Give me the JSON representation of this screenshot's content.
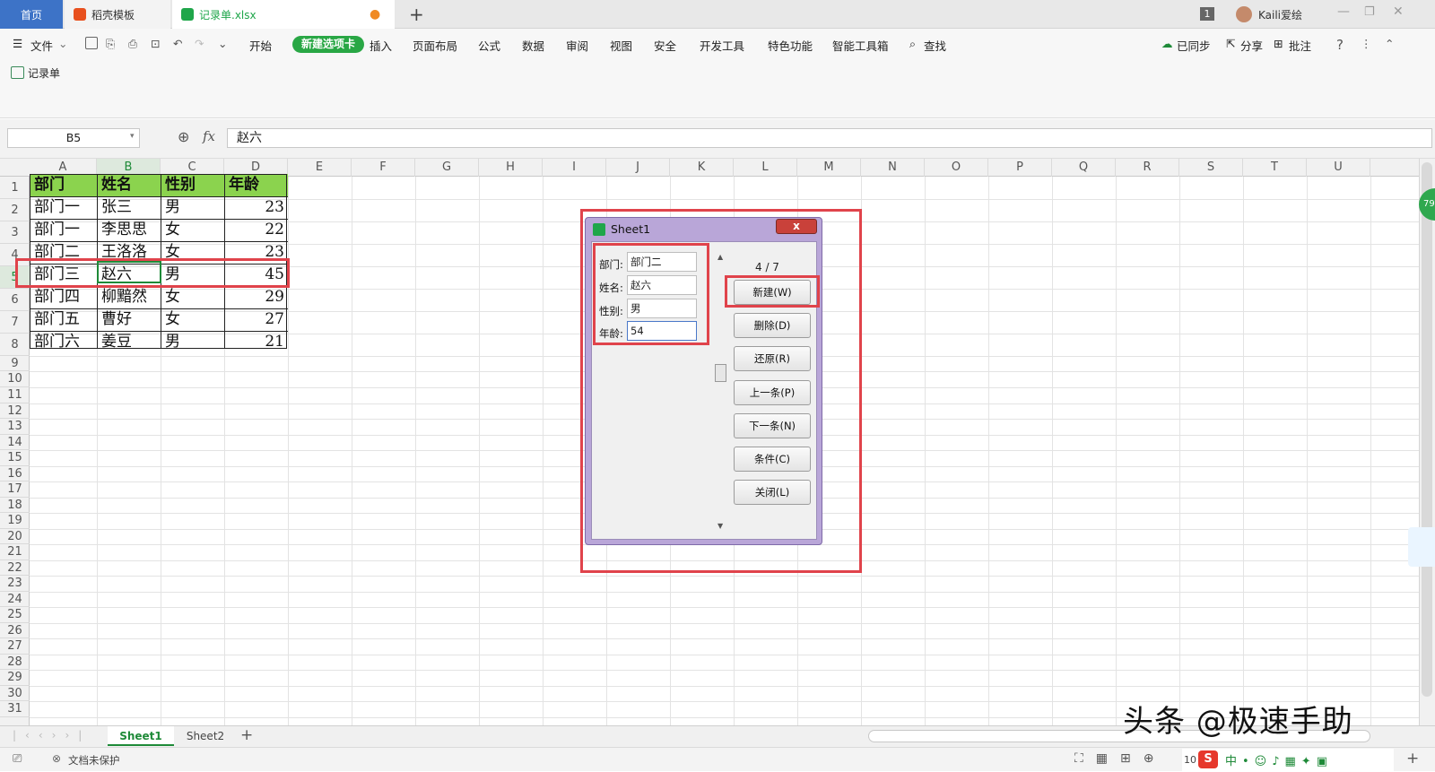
{
  "tabs": {
    "home": "首页",
    "template": "稻壳模板",
    "document": "记录单.xlsx",
    "new_tab_symbol": "+",
    "badge": "1",
    "user": "Kaili爱绘"
  },
  "menu": {
    "file": "文件",
    "items": [
      "开始",
      "新建选项卡",
      "插入",
      "页面布局",
      "公式",
      "数据",
      "审阅",
      "视图",
      "安全",
      "开发工具",
      "特色功能",
      "智能工具箱",
      "查找"
    ],
    "right": [
      "已同步",
      "分享",
      "批注"
    ]
  },
  "ribbon": {
    "record_button": "记录单"
  },
  "formula_bar": {
    "cell_ref": "B5",
    "fx": "fx",
    "content": "赵六"
  },
  "columns": [
    "A",
    "B",
    "C",
    "D",
    "E",
    "F",
    "G",
    "H",
    "I",
    "J",
    "K",
    "L",
    "M",
    "N",
    "O",
    "P",
    "Q",
    "R",
    "S",
    "T",
    "U"
  ],
  "rows": [
    "1",
    "2",
    "3",
    "4",
    "5",
    "6",
    "7",
    "8",
    "9",
    "10",
    "11",
    "12",
    "13",
    "14",
    "15",
    "16",
    "17",
    "18",
    "19",
    "20",
    "21",
    "22",
    "23",
    "24",
    "25",
    "26",
    "27",
    "28",
    "29",
    "30",
    "31"
  ],
  "table": {
    "headers": [
      "部门",
      "姓名",
      "性别",
      "年龄"
    ],
    "rows": [
      [
        "部门一",
        "张三",
        "男",
        "23"
      ],
      [
        "部门一",
        "李思思",
        "女",
        "22"
      ],
      [
        "部门二",
        "王洛洛",
        "女",
        "23"
      ],
      [
        "部门三",
        "赵六",
        "男",
        "45"
      ],
      [
        "部门四",
        "柳黯然",
        "女",
        "29"
      ],
      [
        "部门五",
        "曹好",
        "女",
        "27"
      ],
      [
        "部门六",
        "姜豆",
        "男",
        "21"
      ]
    ]
  },
  "dialog": {
    "title": "Sheet1",
    "close": "x",
    "fields": [
      {
        "label": "部门:",
        "value": "部门二"
      },
      {
        "label": "姓名:",
        "value": "赵六"
      },
      {
        "label": "性别:",
        "value": "男"
      },
      {
        "label": "年龄:",
        "value": "54"
      }
    ],
    "counter": "4 / 7",
    "buttons": [
      "新建(W)",
      "删除(D)",
      "还原(R)",
      "上一条(P)",
      "下一条(N)",
      "条件(C)",
      "关闭(L)"
    ]
  },
  "sheets": [
    "Sheet1",
    "Sheet2"
  ],
  "status": {
    "protect": "文档未保护",
    "zoom": "10"
  },
  "watermark": "头条 @极速手助",
  "side_badge": "79",
  "colors": {
    "accent_green": "#1e8a38",
    "header_fill": "#8bd34e",
    "highlight_red": "#e0434b",
    "dialog_frame": "#b9a6d8",
    "home_tab": "#3d73c7"
  }
}
